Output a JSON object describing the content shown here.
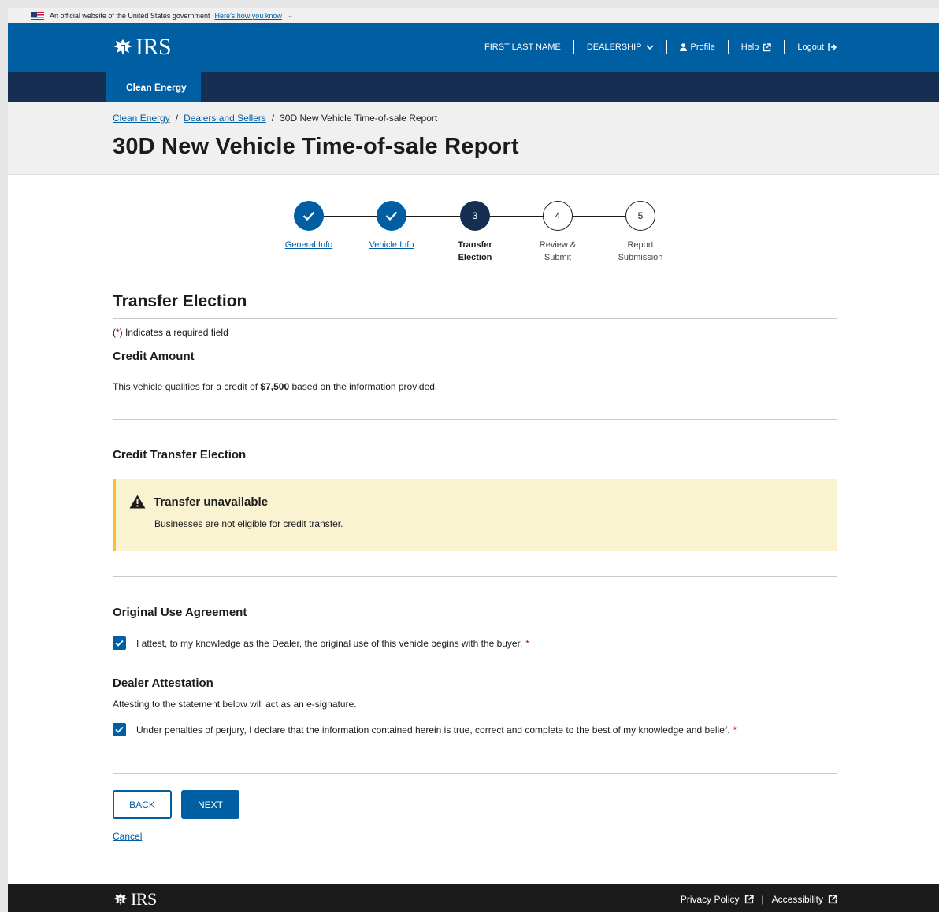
{
  "gov_banner": {
    "text": "An official website of the United States government",
    "link": "Here’s how you know"
  },
  "header": {
    "logo": "IRS",
    "user_name": "FIRST LAST NAME",
    "dealership": "DEALERSHIP",
    "profile": "Profile",
    "help": "Help",
    "logout": "Logout"
  },
  "subnav": {
    "tab": "Clean Energy"
  },
  "breadcrumb": {
    "item1": "Clean Energy",
    "item2": "Dealers and Sellers",
    "current": "30D New Vehicle Time-of-sale Report",
    "sep": "/"
  },
  "page_title": "30D New Vehicle Time-of-sale Report",
  "stepper": {
    "steps": [
      {
        "number": "1",
        "label": "General Info",
        "status": "complete"
      },
      {
        "number": "2",
        "label": "Vehicle Info",
        "status": "complete"
      },
      {
        "number": "3",
        "label_line1": "Transfer",
        "label_line2": "Election",
        "status": "current"
      },
      {
        "number": "4",
        "label_line1": "Review &",
        "label_line2": "Submit",
        "status": "upcoming"
      },
      {
        "number": "5",
        "label_line1": "Report",
        "label_line2": "Submission",
        "status": "upcoming"
      }
    ]
  },
  "form": {
    "section_title": "Transfer Election",
    "required_prefix": "(",
    "required_star": "*",
    "required_suffix": ") Indicates a required field",
    "credit_amount": {
      "heading": "Credit Amount",
      "text_before": "This vehicle qualifies for a credit of ",
      "amount": "$7,500",
      "text_after": " based on the information provided."
    },
    "credit_transfer": {
      "heading": "Credit Transfer Election",
      "alert_title": "Transfer unavailable",
      "alert_body": "Businesses are not eligible for credit transfer."
    },
    "original_use": {
      "heading": "Original Use Agreement",
      "checkbox_label": "I attest, to my knowledge as the Dealer, the original use of this vehicle begins with the buyer.",
      "checked": true
    },
    "dealer_attestation": {
      "heading": "Dealer Attestation",
      "description": "Attesting to the statement below will act as an e-signature.",
      "checkbox_label": "Under penalties of perjury, I declare that the information contained herein is true, correct and complete to the best of my knowledge and belief.",
      "checked": true
    },
    "back_label": "BACK",
    "next_label": "NEXT",
    "cancel_label": "Cancel"
  },
  "footer": {
    "logo": "IRS",
    "privacy": "Privacy Policy",
    "sep": "|",
    "accessibility": "Accessibility"
  },
  "colors": {
    "primary": "#005ea2",
    "navy": "#162e51",
    "warning_bg": "#faf3d1",
    "warning_border": "#ffbe2e",
    "required": "#b50909"
  }
}
